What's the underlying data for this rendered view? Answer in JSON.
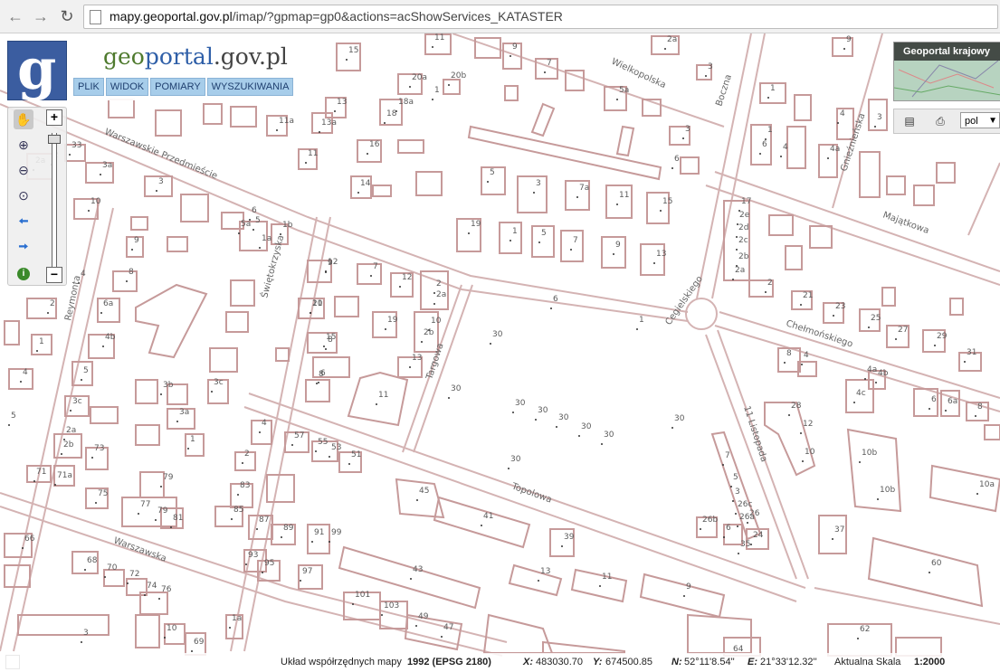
{
  "browser": {
    "url_host": "mapy.geoportal.gov.pl",
    "url_path": "/imap/?gpmap=gp0&actions=acShowServices_KATASTER",
    "back_icon": "arrow-left-icon",
    "forward_icon": "arrow-right-icon",
    "reload_icon": "reload-icon"
  },
  "logo": {
    "letter": "g",
    "brand_part1": "geo",
    "brand_part2": "portal",
    "brand_part3": ".gov.pl"
  },
  "menu": {
    "items": [
      "PLIK",
      "WIDOK",
      "POMIARY",
      "WYSZUKIWANIA"
    ]
  },
  "toolbar": {
    "zoom_in": "+",
    "zoom_out": "−",
    "icons": [
      "hand-pan-icon",
      "zoom-in-icon",
      "zoom-out-icon",
      "zoom-extent-icon",
      "back-arrow-icon",
      "forward-arrow-icon",
      "info-icon"
    ]
  },
  "overview": {
    "title": "Geoportal krajowy"
  },
  "language": {
    "selected": "pol"
  },
  "status": {
    "crs_label": "Układ współrzędnych mapy",
    "crs_value": "1992 (EPSG 2180)",
    "x_label": "X:",
    "x_value": "483030.70",
    "y_label": "Y:",
    "y_value": "674500.85",
    "n_label": "N:",
    "n_value": "52°11'8.54''",
    "e_label": "E:",
    "e_value": "21°33'12.32''",
    "scale_label": "Aktualna Skala",
    "scale_value": "1:2000"
  },
  "map": {
    "streets": [
      "Warszawskie Przedmieście",
      "Wielkopolska",
      "Boczna",
      "Gnieźnieńska",
      "Majątkowa",
      "Reymonta",
      "Świętokrzyska",
      "Targowa",
      "Cegielskiego",
      "Chełmońskiego",
      "11 Listopada",
      "Topolowa",
      "Warszawska"
    ],
    "numbers": [
      "15",
      "11",
      "9",
      "2a",
      "9",
      "7",
      "3",
      "1",
      "20a",
      "20b",
      "18a",
      "18",
      "16",
      "13",
      "13a",
      "11",
      "14",
      "12",
      "10",
      "8",
      "6",
      "4",
      "2a",
      "2",
      "11a",
      "5a",
      "3",
      "1",
      "6",
      "4",
      "1",
      "6",
      "4a",
      "4",
      "3",
      "5",
      "3",
      "7a",
      "11",
      "15",
      "19",
      "1",
      "5",
      "7",
      "9",
      "13",
      "17",
      "2e",
      "2d",
      "2c",
      "2b",
      "2a",
      "2",
      "21",
      "23",
      "25",
      "27",
      "29",
      "31",
      "33",
      "3a",
      "3",
      "10",
      "9",
      "8",
      "6a",
      "5a",
      "6",
      "5",
      "1b",
      "1a",
      "9",
      "7",
      "12",
      "2",
      "2a",
      "21",
      "19",
      "10",
      "2b",
      "15",
      "13",
      "8",
      "11",
      "6",
      "1",
      "30",
      "30",
      "30",
      "30",
      "30",
      "30",
      "30",
      "30",
      "30",
      "28",
      "12",
      "10",
      "8",
      "4",
      "4a",
      "4b",
      "4c",
      "6",
      "6a",
      "8",
      "10b",
      "10b",
      "10a",
      "4b",
      "3b",
      "3a",
      "3c",
      "1",
      "2a",
      "2b",
      "73",
      "71",
      "71a",
      "75",
      "77",
      "79",
      "81",
      "79",
      "4",
      "57",
      "55",
      "53",
      "51",
      "2",
      "83",
      "85",
      "87",
      "89",
      "91",
      "93",
      "95",
      "97",
      "99",
      "101",
      "103",
      "49",
      "47",
      "43",
      "45",
      "41",
      "39",
      "13",
      "11",
      "9",
      "7",
      "5",
      "3",
      "26c",
      "26a",
      "26",
      "26b",
      "6",
      "24",
      "35",
      "37",
      "60",
      "62",
      "64",
      "66",
      "68",
      "70",
      "72",
      "74",
      "76",
      "10",
      "69",
      "1a",
      "3",
      "5",
      "4",
      "2",
      "1",
      "5",
      "3c"
    ]
  }
}
